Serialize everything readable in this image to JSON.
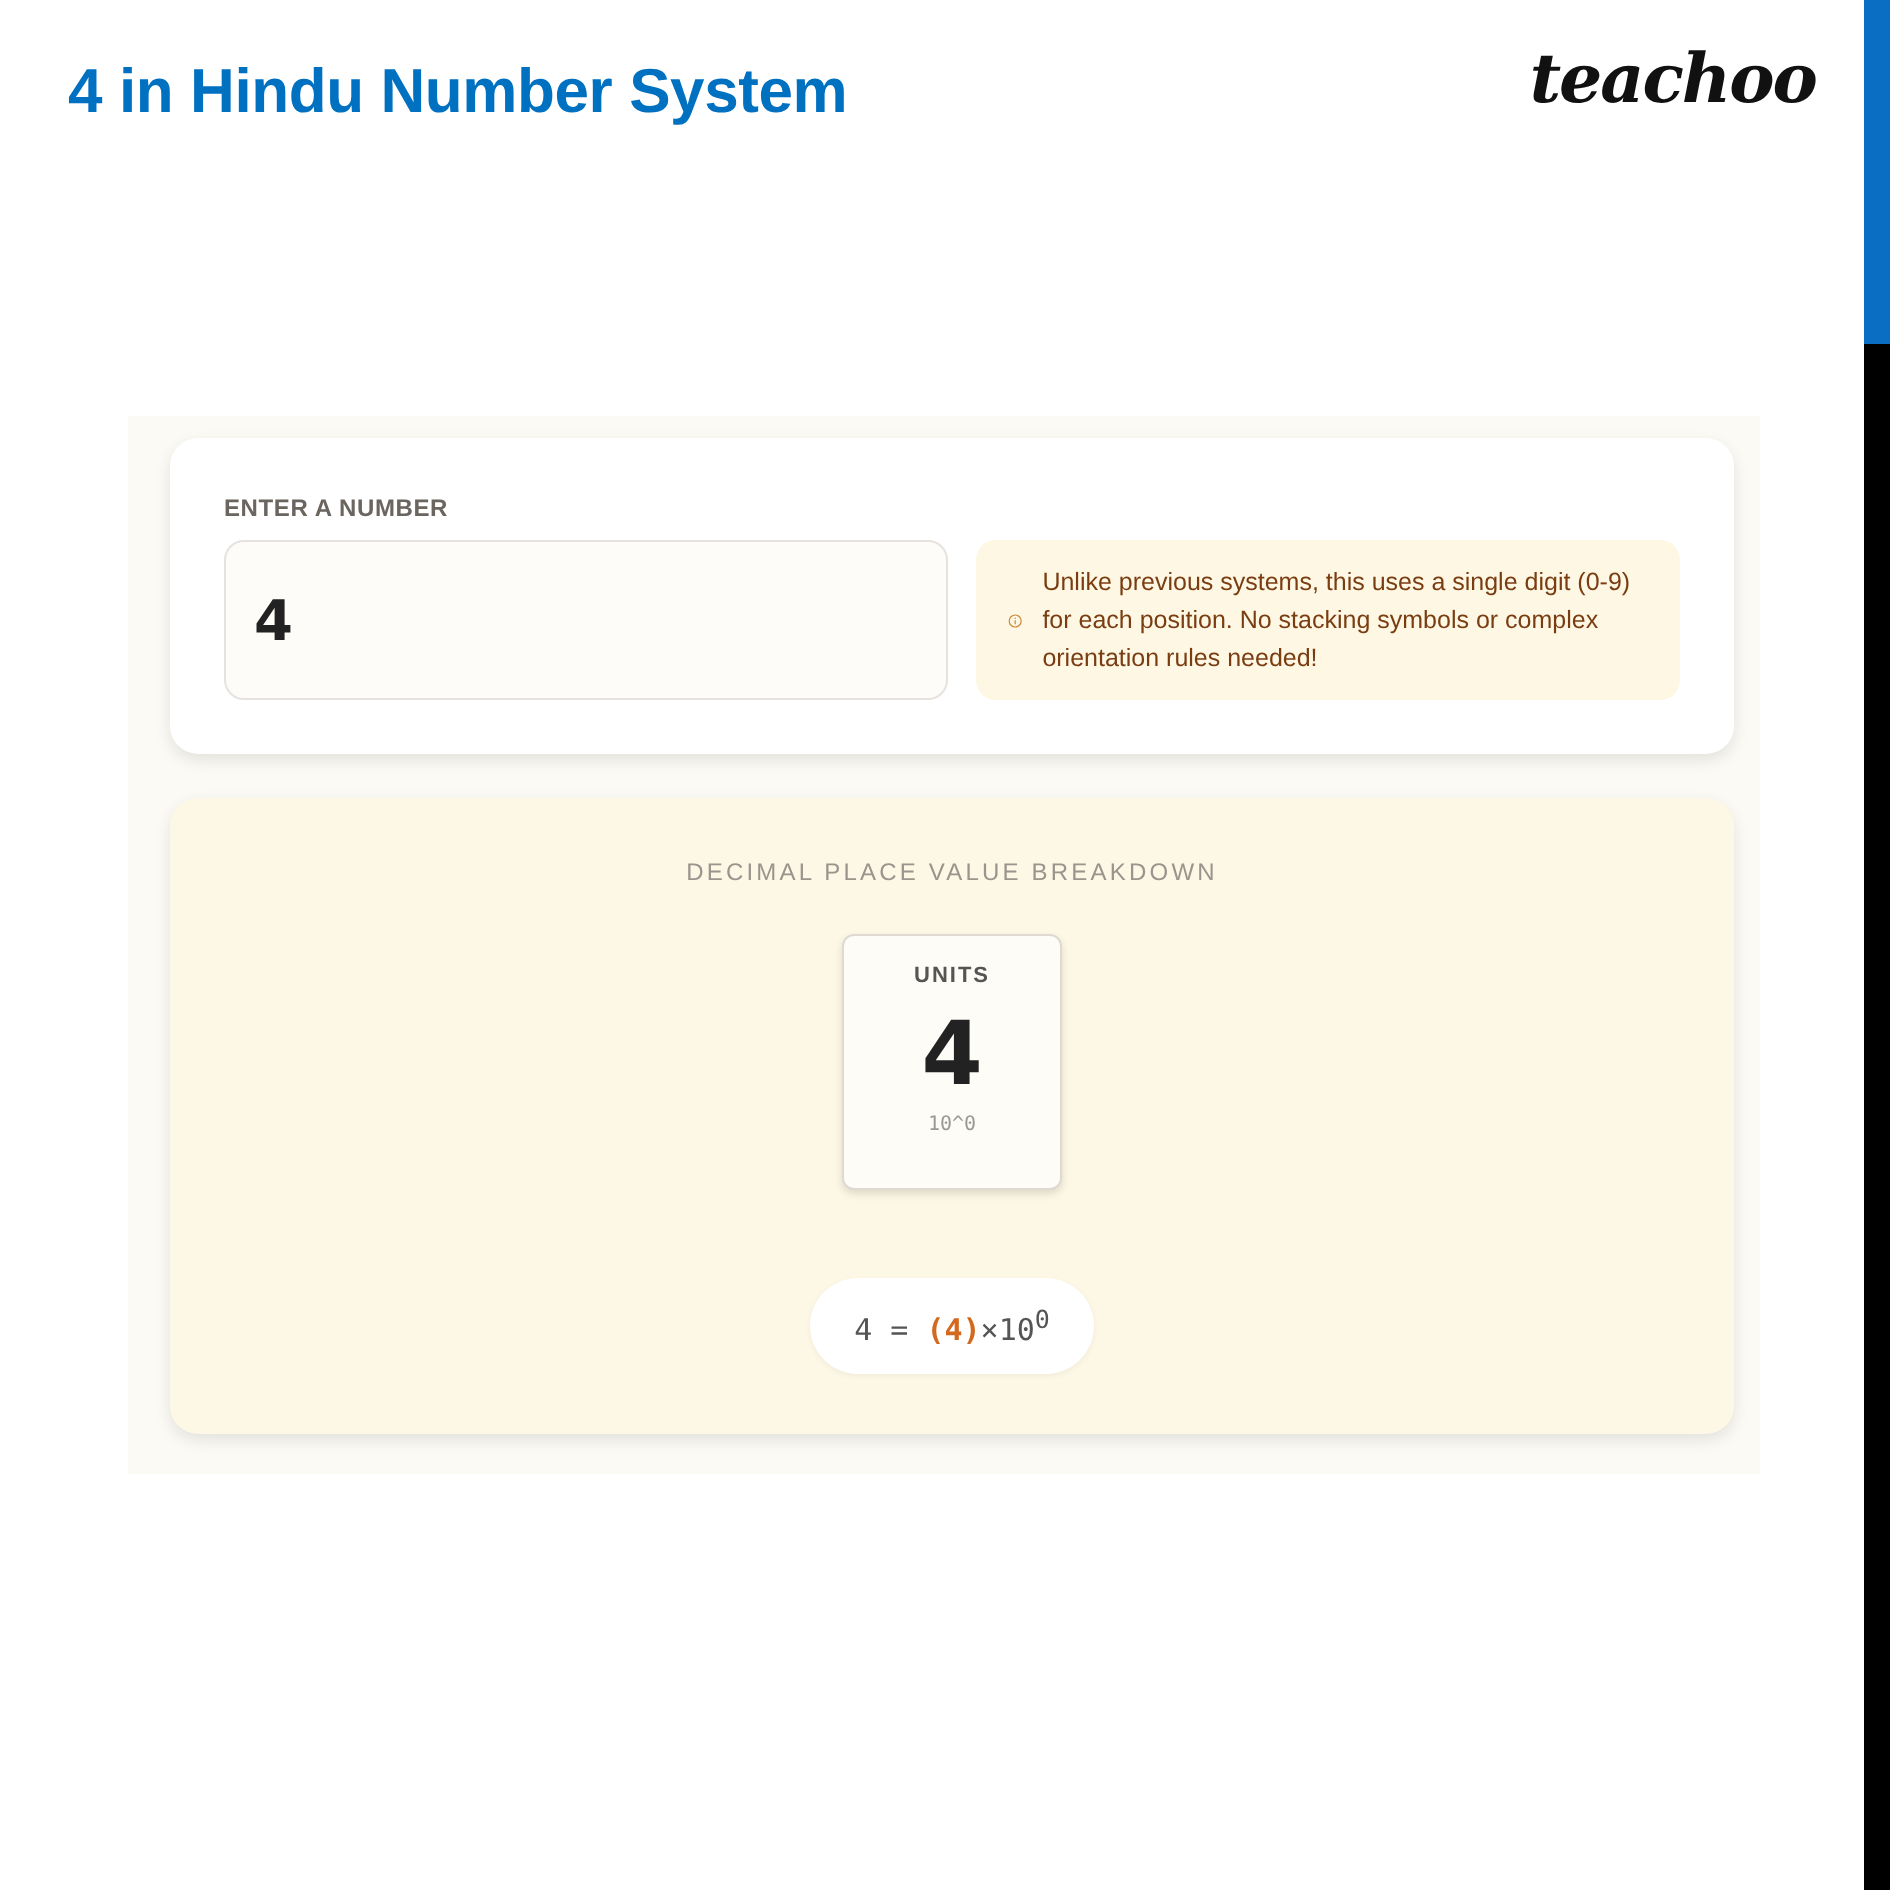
{
  "slide": {
    "title": "4 in Hindu Number System",
    "logo": "teachoo"
  },
  "input_card": {
    "label": "ENTER A NUMBER",
    "value": "4",
    "note": "Unlike previous systems, this uses a single digit (0-9) for each position. No stacking symbols or complex orientation rules needed!"
  },
  "breakdown": {
    "title": "DECIMAL PLACE VALUE BREAKDOWN",
    "places": [
      {
        "label": "UNITS",
        "digit": "4",
        "power": "10^0"
      }
    ],
    "equation": {
      "lhs": "4 =",
      "terms": [
        {
          "digit": "(4)",
          "factor": "×10$^{0}$"
        }
      ]
    }
  }
}
